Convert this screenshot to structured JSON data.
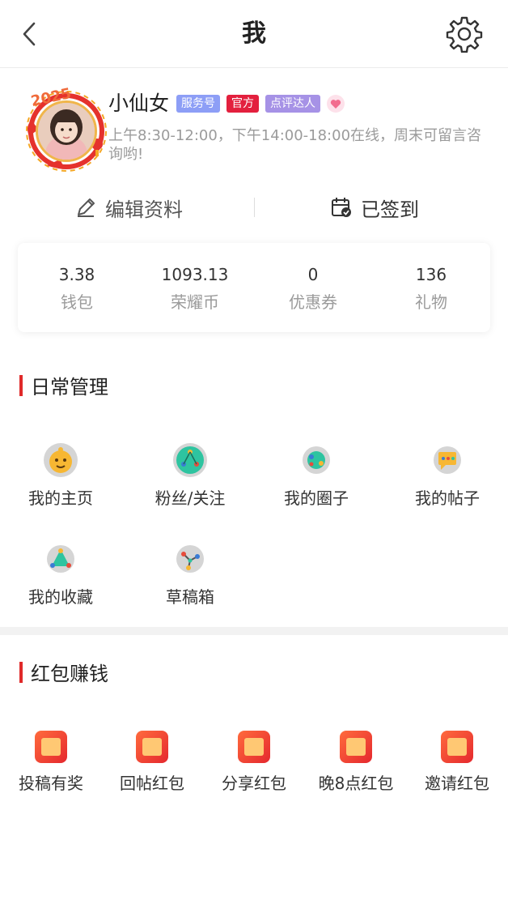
{
  "header": {
    "title": "我",
    "back_icon": "chevron-left-icon",
    "settings_icon": "gear-icon"
  },
  "profile": {
    "year_badge": "2025",
    "username": "小仙女",
    "tags": {
      "service": "服务号",
      "official": "官方",
      "reviewer": "点评达人"
    },
    "bio": "上午8:30-12:00，下午14:00-18:00在线，周末可留言咨询哟!"
  },
  "actions": {
    "edit_label": "编辑资料",
    "sign_label": "已签到"
  },
  "wallet": {
    "items": [
      {
        "value": "3.38",
        "label": "钱包"
      },
      {
        "value": "1093.13",
        "label": "荣耀币"
      },
      {
        "value": "0",
        "label": "优惠券"
      },
      {
        "value": "136",
        "label": "礼物"
      }
    ]
  },
  "daily": {
    "title": "日常管理",
    "items": [
      {
        "label": "我的主页",
        "icon": "home-face-icon"
      },
      {
        "label": "粉丝/关注",
        "icon": "fans-icon"
      },
      {
        "label": "我的圈子",
        "icon": "circle-icon"
      },
      {
        "label": "我的帖子",
        "icon": "post-icon"
      },
      {
        "label": "我的收藏",
        "icon": "favorite-icon"
      },
      {
        "label": "草稿箱",
        "icon": "draft-icon"
      }
    ]
  },
  "rewards": {
    "title": "红包赚钱",
    "items": [
      {
        "label": "投稿有奖",
        "icon": "red-packet-icon"
      },
      {
        "label": "回帖红包",
        "icon": "red-packet-icon"
      },
      {
        "label": "分享红包",
        "icon": "red-packet-icon"
      },
      {
        "label": "晚8点红包",
        "icon": "red-packet-icon"
      },
      {
        "label": "邀请红包",
        "icon": "red-packet-icon"
      }
    ]
  },
  "colors": {
    "accent": "#e02a2a",
    "tag_service": "#8d9ef6",
    "tag_official": "#e3203e",
    "tag_reviewer": "#a692e6"
  }
}
